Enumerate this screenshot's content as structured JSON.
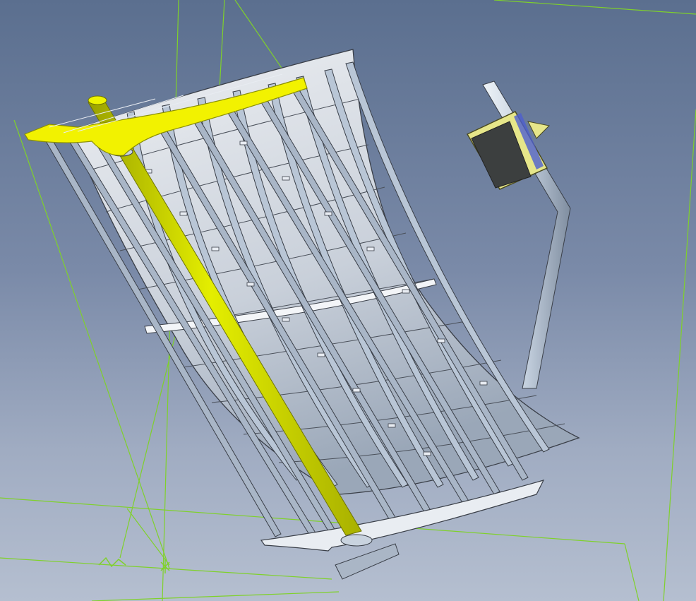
{
  "scene": {
    "description_free": true,
    "colors": {
      "background_top": "#5b6f8f",
      "background_bottom": "#b5bfd0",
      "construction_lines": "#7fd12a",
      "reflector_panel": "#d8dde6",
      "reflector_edge": "#3a3f48",
      "rib": "#b9c6d6",
      "support_pole": "#d6e000",
      "top_bracket": "#f2f200",
      "receiver_frame": "#e6e68a",
      "receiver_face": "#3c3f3f",
      "receiver_glass": "#4d5fd0",
      "mast": "#c3cfdd"
    },
    "icons": {
      "origin_marker": "axis-triad-icon"
    }
  }
}
